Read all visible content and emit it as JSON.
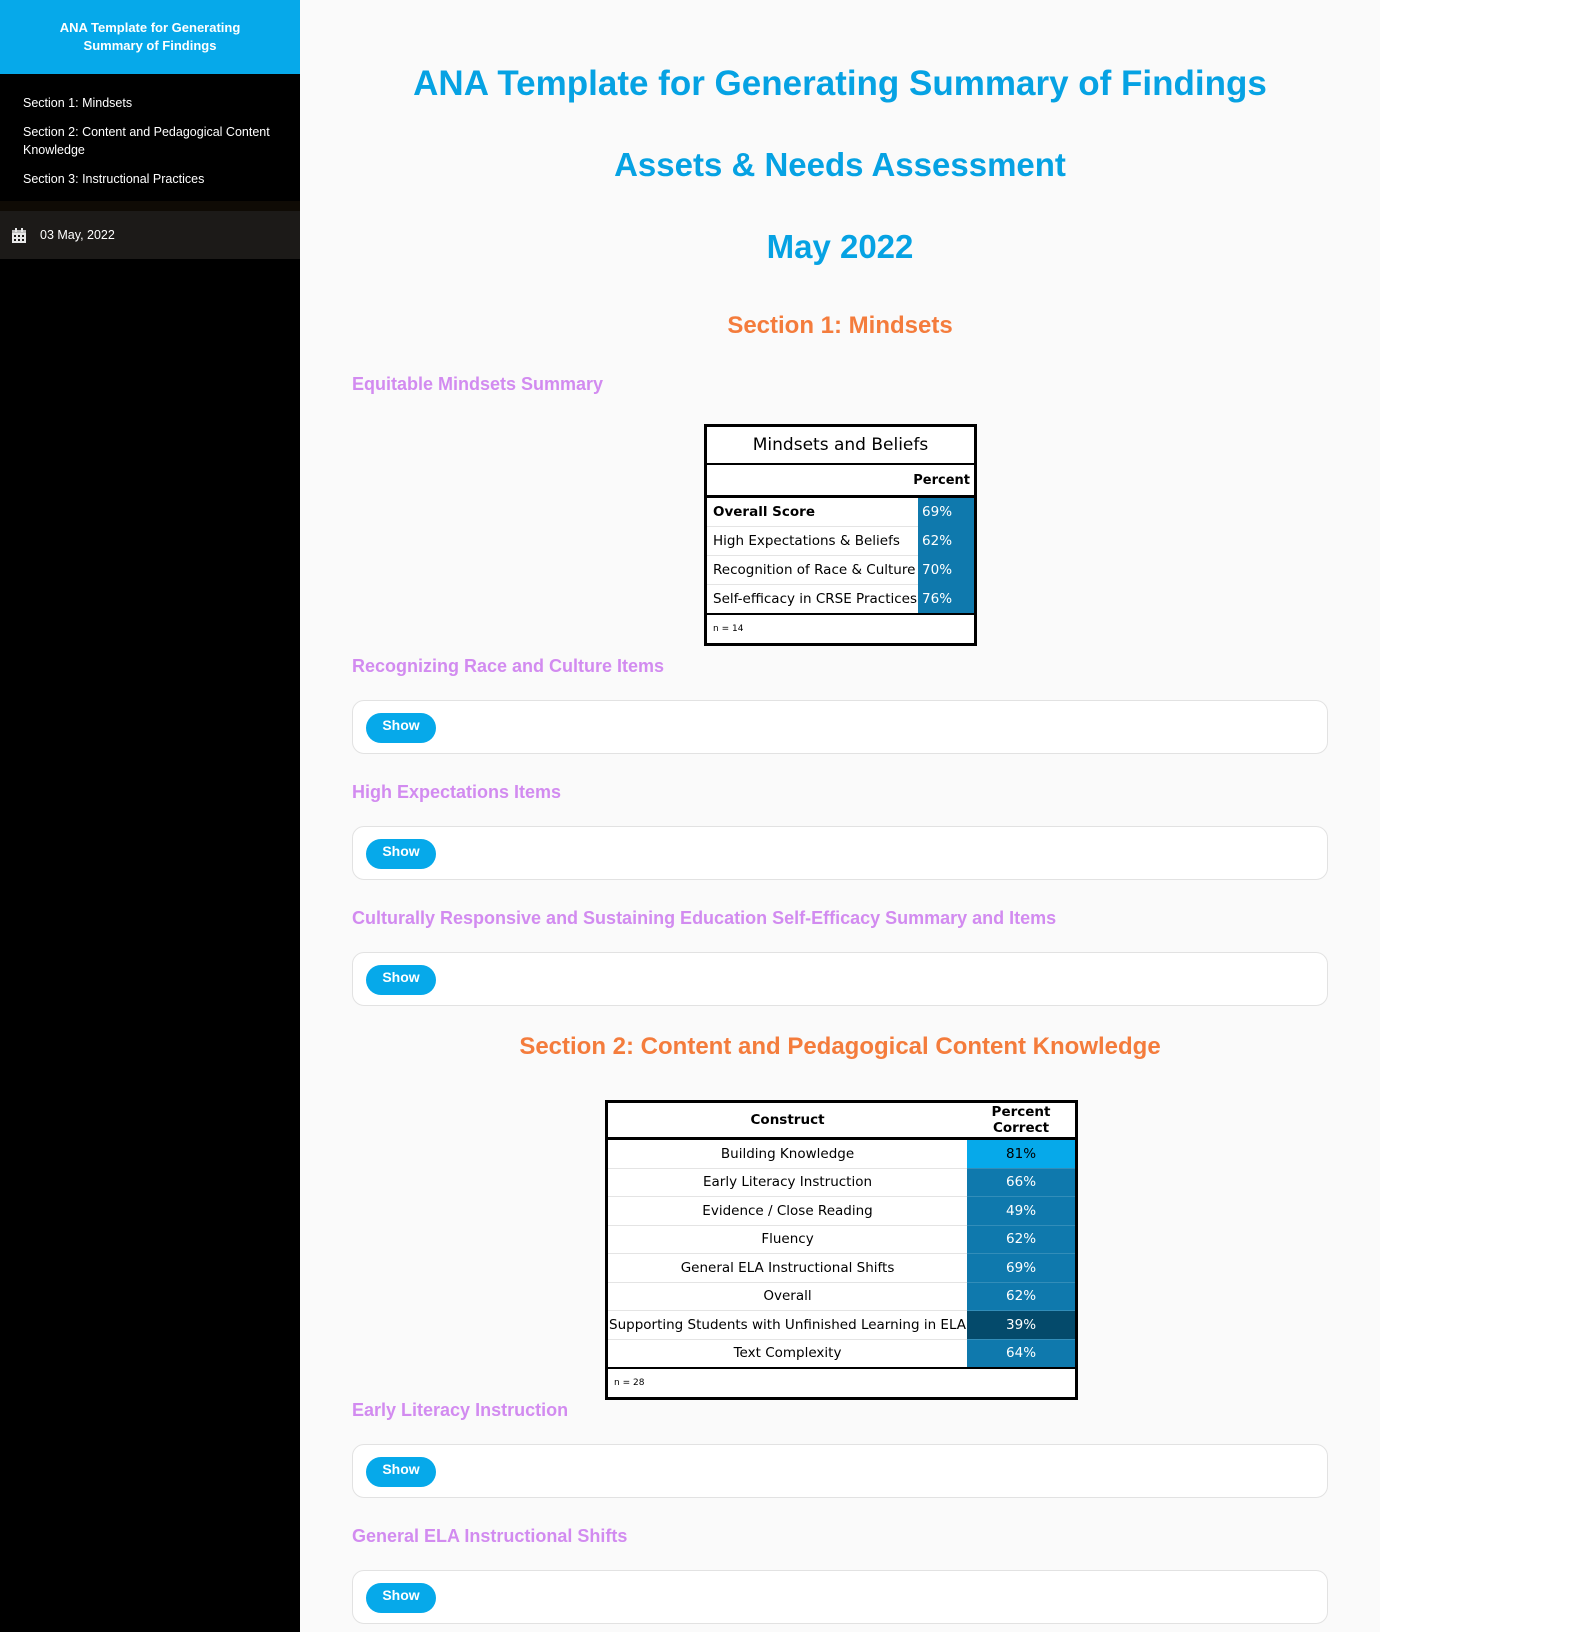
{
  "sidebar": {
    "header_title": "ANA Template for Generating Summary of Findings",
    "toc": [
      {
        "label": "Section 1: Mindsets"
      },
      {
        "label": "Section 2: Content and Pedagogical Content Knowledge"
      },
      {
        "label": "Section 3: Instructional Practices"
      }
    ],
    "date": "03 May, 2022",
    "date_icon": "calendar-icon"
  },
  "main": {
    "title": "ANA Template for Generating Summary of Findings",
    "subtitle": "Assets & Needs Assessment",
    "date": "May 2022",
    "section1": {
      "heading": "Section 1: Mindsets",
      "summary_heading": "Equitable Mindsets Summary",
      "table": {
        "caption": "Mindsets and Beliefs",
        "column_header": "Percent",
        "rows": [
          {
            "label": "Overall Score",
            "value": "69%"
          },
          {
            "label": "High Expectations & Beliefs",
            "value": "62%"
          },
          {
            "label": "Recognition of Race & Culture",
            "value": "70%"
          },
          {
            "label": "Self-efficacy in CRSE Practices",
            "value": "76%"
          }
        ],
        "note": "n = 14"
      },
      "collapsibles": [
        {
          "heading": "Recognizing Race and Culture Items",
          "button": "Show"
        },
        {
          "heading": "High Expectations Items",
          "button": "Show"
        },
        {
          "heading": "Culturally Responsive and Sustaining Education Self-Efficacy Summary and Items",
          "button": "Show"
        }
      ]
    },
    "section2": {
      "heading": "Section 2: Content and Pedagogical Content Knowledge",
      "table": {
        "col_construct": "Construct",
        "col_percent": "Percent Correct",
        "rows": [
          {
            "label": "Building Knowledge",
            "value": "81%",
            "color": "#06a9ea",
            "text_color": "#000000"
          },
          {
            "label": "Early Literacy Instruction",
            "value": "66%",
            "color": "#0f79ad",
            "text_color": "#ffffff"
          },
          {
            "label": "Evidence / Close Reading",
            "value": "49%",
            "color": "#0f79ad",
            "text_color": "#ffffff"
          },
          {
            "label": "Fluency",
            "value": "62%",
            "color": "#0f79ad",
            "text_color": "#ffffff"
          },
          {
            "label": "General ELA Instructional Shifts",
            "value": "69%",
            "color": "#0f79ad",
            "text_color": "#ffffff"
          },
          {
            "label": "Overall",
            "value": "62%",
            "color": "#0f79ad",
            "text_color": "#ffffff"
          },
          {
            "label": "Supporting Students with Unfinished Learning in ELA",
            "value": "39%",
            "color": "#044a6b",
            "text_color": "#ffffff"
          },
          {
            "label": "Text Complexity",
            "value": "64%",
            "color": "#0f79ad",
            "text_color": "#ffffff"
          }
        ],
        "note": "n = 28"
      },
      "collapsibles": [
        {
          "heading": "Early Literacy Instruction",
          "button": "Show"
        },
        {
          "heading": "General ELA Instructional Shifts",
          "button": "Show"
        }
      ]
    }
  },
  "colors": {
    "accent_blue": "#06a9ea",
    "title_blue": "#06a2e3",
    "section_orange": "#f47c3c",
    "subheading_purple": "#d28bf0",
    "cell_blue": "#0f79ad"
  }
}
